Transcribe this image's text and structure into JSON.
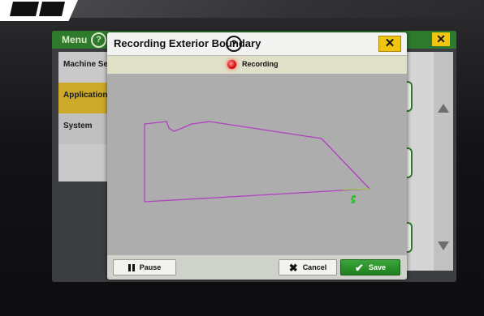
{
  "background_app": {
    "menu_label": "Menu",
    "sidebar": [
      {
        "label": "Machine Settings",
        "active": false
      },
      {
        "label": "Applications",
        "active": true
      },
      {
        "label": "System",
        "active": false
      }
    ]
  },
  "dialog": {
    "title": "Recording Exterior Boundary",
    "help_icon": "?",
    "close_icon": "✕",
    "status_text": "Recording",
    "pause_label": "Pause",
    "cancel_label": "Cancel",
    "save_label": "Save"
  },
  "colors": {
    "accent_yellow": "#f1c40f",
    "brand_green": "#2d7a2d",
    "boundary_line": "#b13fc1",
    "recording_red": "#e01010",
    "save_green": "#2b8f2b"
  },
  "icons": {
    "help": "help-icon",
    "close": "close-icon",
    "recording": "recording-dot-icon",
    "pause": "pause-icon",
    "cancel": "x-icon",
    "save": "checkmark-icon",
    "vehicle": "vehicle-marker-icon",
    "scroll_up": "scroll-up-arrow-icon",
    "scroll_down": "scroll-down-arrow-icon"
  }
}
